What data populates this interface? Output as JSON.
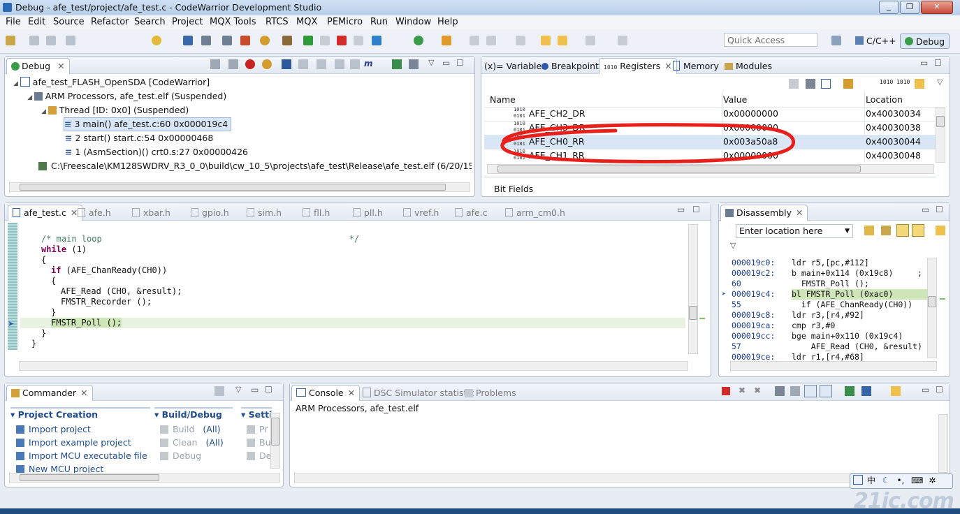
{
  "window": {
    "title": "Debug - afe_test/project/afe_test.c - CodeWarrior Development Studio",
    "min": "_",
    "max": "❐",
    "close": "✕"
  },
  "menu": [
    "File",
    "Edit",
    "Source",
    "Refactor",
    "Search",
    "Project",
    "MQX Tools",
    "RTCS",
    "MQX",
    "PEMicro",
    "Run",
    "Window",
    "Help"
  ],
  "toolbar": {
    "quick_access_placeholder": "Quick Access",
    "perspectives": [
      "C/C++",
      "Debug"
    ]
  },
  "debug_view": {
    "tab": "Debug",
    "tree": [
      "afe_test_FLASH_OpenSDA [CodeWarrior]",
      "ARM Processors, afe_test.elf (Suspended)",
      "Thread [ID: 0x0] (Suspended)",
      "3 main() afe_test.c:60 0x000019c4",
      "2 start() start.c:54 0x00000468",
      "1 (AsmSection)() crt0.s:27 0x00000426",
      "C:\\Freescale\\KM128SWDRV_R3_0_0\\build\\cw_10_5\\projects\\afe_test\\Release\\afe_test.elf (6/20/15 8:50 P"
    ]
  },
  "registers_view": {
    "tabs": [
      "(x)= Variables",
      "Breakpoints",
      "Registers",
      "Memory",
      "Modules"
    ],
    "columns": [
      "Name",
      "Value",
      "Location"
    ],
    "rows": [
      {
        "name": "AFE_CH2_DR",
        "value": "0x00000000",
        "location": "0x40030034"
      },
      {
        "name": "AFE_CH3_DR",
        "value": "0x00000000",
        "location": "0x40030038"
      },
      {
        "name": "AFE_CH0_RR",
        "value": "0x003a50a8",
        "location": "0x40030044"
      },
      {
        "name": "AFE_CH1_RR",
        "value": "0x00000000",
        "location": "0x40030048"
      }
    ],
    "bit_fields_label": "Bit Fields",
    "highlight_color": "#e8201c"
  },
  "editor": {
    "tabs": [
      "afe_test.c",
      "afe.h",
      "xbar.h",
      "gpio.h",
      "sim.h",
      "fll.h",
      "pll.h",
      "vref.h",
      "afe.c",
      "arm_cm0.h"
    ],
    "lines": [
      {
        "indent": 1,
        "parts": [
          {
            "t": "/* main loop                                                 */",
            "c": "cm"
          }
        ]
      },
      {
        "indent": 1,
        "parts": [
          {
            "t": "while",
            "c": "kw"
          },
          {
            "t": " (1)",
            "c": ""
          }
        ]
      },
      {
        "indent": 1,
        "parts": [
          {
            "t": "{",
            "c": ""
          }
        ]
      },
      {
        "indent": 2,
        "parts": [
          {
            "t": "if",
            "c": "kw"
          },
          {
            "t": " (AFE_ChanReady(CH0))",
            "c": ""
          }
        ]
      },
      {
        "indent": 2,
        "parts": [
          {
            "t": "{",
            "c": ""
          }
        ]
      },
      {
        "indent": 3,
        "parts": [
          {
            "t": "AFE_Read (CH0, &result);",
            "c": ""
          }
        ]
      },
      {
        "indent": 3,
        "parts": [
          {
            "t": "FMSTR_Recorder ();",
            "c": ""
          }
        ]
      },
      {
        "indent": 2,
        "parts": [
          {
            "t": "}",
            "c": ""
          }
        ]
      },
      {
        "indent": 2,
        "parts": [
          {
            "t": "FMSTR_Poll ();",
            "c": ""
          }
        ],
        "current": true
      },
      {
        "indent": 1,
        "parts": [
          {
            "t": "}",
            "c": ""
          }
        ]
      },
      {
        "indent": 0,
        "parts": [
          {
            "t": "}",
            "c": ""
          }
        ]
      }
    ]
  },
  "disassembly": {
    "tab": "Disassembly",
    "location_placeholder": "Enter location here",
    "lines": [
      {
        "addr": "000019c0:",
        "code": "ldr r5,[pc,#112]"
      },
      {
        "addr": "000019c2:",
        "code": "b main+0x114 (0x19c8)     ;"
      },
      {
        "addr": "60",
        "code": "  FMSTR_Poll ();"
      },
      {
        "addr": "000019c4:",
        "code": "bl FMSTR_Poll (0xac0)",
        "current": true
      },
      {
        "addr": "55",
        "code": "  if (AFE_ChanReady(CH0))"
      },
      {
        "addr": "000019c8:",
        "code": "ldr r3,[r4,#92]"
      },
      {
        "addr": "000019ca:",
        "code": "cmp r3,#0"
      },
      {
        "addr": "000019cc:",
        "code": "bge main+0x110 (0x19c4)"
      },
      {
        "addr": "57",
        "code": "    AFE_Read (CH0, &result)"
      },
      {
        "addr": "000019ce:",
        "code": "ldr r1,[r4,#68]"
      }
    ]
  },
  "commander": {
    "tab": "Commander",
    "groups": [
      {
        "title": "Project Creation",
        "items": [
          "Import project",
          "Import example project",
          "Import MCU executable file",
          "New MCU project"
        ]
      },
      {
        "title": "Build/Debug",
        "items": [
          {
            "label": "Build",
            "suffix": "(All)"
          },
          {
            "label": "Clean",
            "suffix": "(All)"
          },
          {
            "label": "Debug",
            "suffix": ""
          }
        ]
      },
      {
        "title": "Setti",
        "items": [
          "Pr",
          "Bu",
          "De"
        ]
      }
    ]
  },
  "console": {
    "tabs": [
      "Console",
      "DSC Simulator statistic",
      "Problems"
    ],
    "text": "ARM Processors, afe_test.elf"
  },
  "ime": {
    "lang": "中"
  },
  "watermark": "21ic.com"
}
